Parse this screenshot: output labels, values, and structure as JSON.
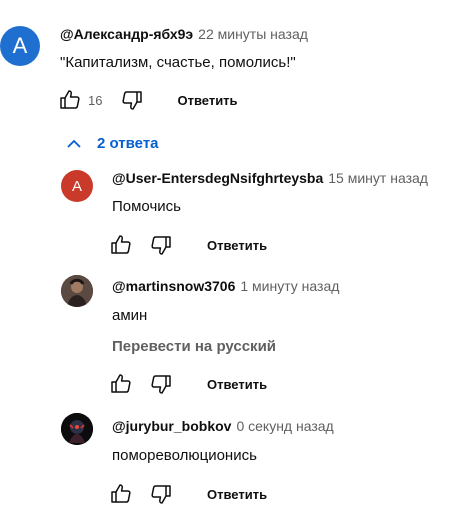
{
  "comment": {
    "avatar_letter": "А",
    "author": "@Александр-ябх9э",
    "time": "22 минуты назад",
    "text": "\"Капитализм, счастье, помолись!\"",
    "likes": "16",
    "reply_label": "Ответить",
    "replies_toggle": "2 ответа",
    "avatar_color": "#1f6fd1"
  },
  "replies": [
    {
      "avatar_letter": "A",
      "avatar_color": "#c93a2a",
      "author": "@User-EntersdegNsifghrteysba",
      "time": "15 минут назад",
      "text": "Помочись",
      "reply_label": "Ответить"
    },
    {
      "author": "@martinsnow3706",
      "time": "1 минуту назад",
      "text": "амин",
      "translate": "Перевести на русский",
      "reply_label": "Ответить"
    },
    {
      "author": "@jurybur_bobkov",
      "time": "0 секунд назад",
      "text": "помореволюционись",
      "reply_label": "Ответить"
    }
  ]
}
